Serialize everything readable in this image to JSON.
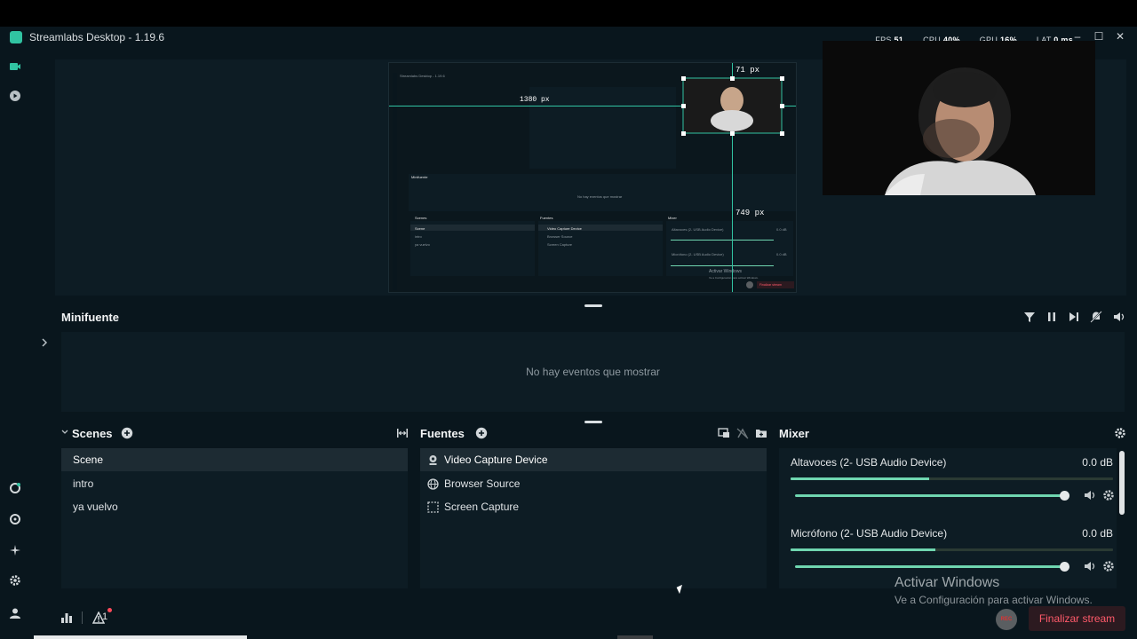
{
  "window": {
    "title": "Streamlabs Desktop - 1.19.6",
    "stats": {
      "fps_label": "FPS",
      "fps_value": "51",
      "cpu_label": "CPU",
      "cpu_value": "40%",
      "gpu_label": "GPU",
      "gpu_value": "16%",
      "lat_label": "LAT",
      "lat_value": "0 ms"
    }
  },
  "preview": {
    "title": "Streamlabs Desktop - 1.19.6",
    "width_label": "1380 px",
    "height_top_label": "71 px",
    "height_bottom_label": "749 px",
    "mini_minifuente": "Minifuente",
    "mini_empty": "No hay eventos que mostrar",
    "mini_scenes": "Scenes",
    "mini_fuentes": "Fuentes",
    "mini_mixer": "Mixer",
    "mini_scene_items": [
      "Scene",
      "intro",
      "ya vuelvo"
    ],
    "mini_source_items": [
      "Video Capture Device",
      "Browser Source",
      "Screen Capture"
    ],
    "mini_mixer_items": [
      "Altavoces (2- USB Audio Device)",
      "Micrófono (2- USB Audio Device)"
    ],
    "mini_db": "0.0 dB",
    "mini_watermark1": "Activar Windows",
    "mini_watermark2": "Ve a Configuración para activar Windows.",
    "mini_end": "Finalizar stream"
  },
  "minifuente": {
    "title": "Minifuente",
    "empty_message": "No hay eventos que mostrar"
  },
  "scenes": {
    "title": "Scenes",
    "items": [
      "Scene",
      "intro",
      "ya vuelvo"
    ],
    "selected_index": 0
  },
  "fuentes": {
    "title": "Fuentes",
    "items": [
      {
        "label": "Video Capture Device",
        "icon": "webcam-icon"
      },
      {
        "label": "Browser Source",
        "icon": "globe-icon"
      },
      {
        "label": "Screen Capture",
        "icon": "screen-capture-icon"
      }
    ],
    "selected_index": 0
  },
  "mixer": {
    "title": "Mixer",
    "channels": [
      {
        "name": "Altavoces (2- USB Audio Device)",
        "db": "0.0 dB",
        "level": 0.43,
        "volume": 1.0
      },
      {
        "name": "Micrófono (2- USB Audio Device)",
        "db": "0.0 dB",
        "level": 0.45,
        "volume": 1.0
      }
    ]
  },
  "watermark": {
    "line1": "Activar Windows",
    "line2": "Ve a Configuración para activar Windows."
  },
  "footer": {
    "rec_label": "REC",
    "end_stream_label": "Finalizar stream",
    "alert_count": "1"
  },
  "colors": {
    "background": "#09161d",
    "panel": "#0d1c24",
    "accent": "#31c3a2",
    "meter": "#6fd6b0",
    "end_stream": "#ff5a6a"
  }
}
